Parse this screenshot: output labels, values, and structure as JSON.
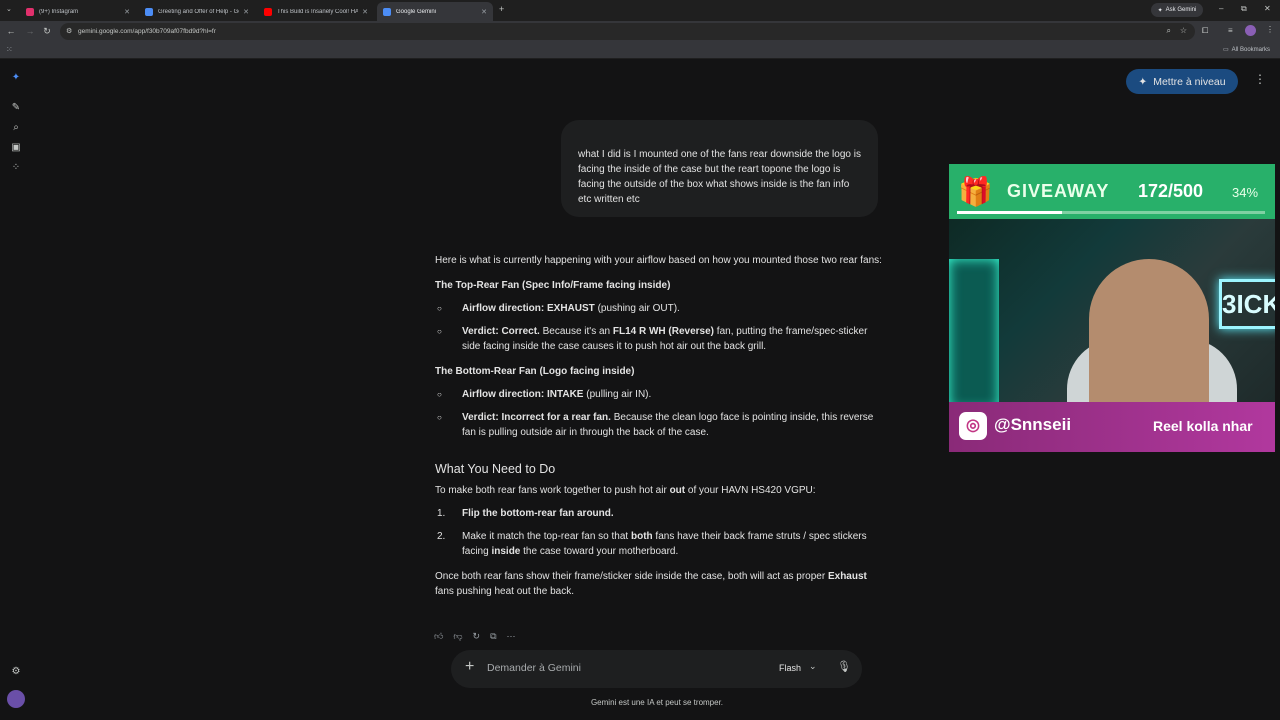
{
  "browser": {
    "tabs": [
      {
        "label": "(9+) Instagram",
        "favicon_color": "#e1306c"
      },
      {
        "label": "Greeting and Offer of Help - Ge",
        "favicon_color": "#4c8df6"
      },
      {
        "label": "This Build is Insanely Cool! HAV",
        "favicon_color": "#ff0000"
      },
      {
        "label": "Google Gemini",
        "favicon_color": "#4c8df6"
      }
    ],
    "ask_gemini": "Ask Gemini",
    "url": "gemini.google.com/app/f30b709af07fbd9d?hl=fr",
    "bookmarks_label": "All Bookmarks"
  },
  "header": {
    "upgrade_label": "Mettre à niveau"
  },
  "user_message": "what I did is I mounted one of the fans rear downside the logo is facing the inside of the case but the reart topone the logo is facing the outside of the box what shows inside is the fan info etc written etc",
  "answer": {
    "intro": "Here is what is currently happening with your airflow based on how you mounted those two rear fans:",
    "section1": {
      "heading": "The Top-Rear Fan (Spec Info/Frame facing inside)",
      "b1_bold": "Airflow direction: EXHAUST",
      "b1_rest": " (pushing air OUT).",
      "b2_bold": "Verdict: Correct.",
      "b2_a": " Because it's an ",
      "b2_bold2": "FL14 R WH (Reverse)",
      "b2_b": " fan, putting the frame/spec-sticker side facing inside the case causes it to push hot air out the back grill."
    },
    "section2": {
      "heading": "The Bottom-Rear Fan (Logo facing inside)",
      "b1_bold": "Airflow direction: INTAKE",
      "b1_rest": " (pulling air IN).",
      "b2_bold": "Verdict: Incorrect for a rear fan.",
      "b2_rest": " Because the clean logo face is pointing inside, this reverse fan is pulling outside air in through the back of the case."
    },
    "todo_heading": "What You Need to Do",
    "todo_intro_a": "To make both rear fans work together to push hot air ",
    "todo_intro_bold": "out",
    "todo_intro_b": " of your HAVN HS420 VGPU:",
    "steps": {
      "n1": "1.",
      "s1_bold": "Flip the bottom-rear fan around.",
      "n2": "2.",
      "s2_a": "Make it match the top-rear fan so that ",
      "s2_bold": "both",
      "s2_b": " fans have their back frame struts / spec stickers facing ",
      "s2_bold2": "inside",
      "s2_c": " the case toward your motherboard."
    },
    "closing_a": "Once both rear fans show their frame/sticker side inside the case, both will act as proper ",
    "closing_bold": "Exhaust",
    "closing_b": " fans pushing heat out the back."
  },
  "input": {
    "placeholder": "Demander à Gemini",
    "model": "Flash"
  },
  "disclaimer": "Gemini est une IA et peut se tromper.",
  "overlay": {
    "giveaway_title": "GIVEAWAY",
    "count": "172/500",
    "percent": "34%",
    "progress": 0.34,
    "neon_text": "3ICK",
    "handle": "@Snnseii",
    "footer_text": "Reel kolla nhar"
  }
}
